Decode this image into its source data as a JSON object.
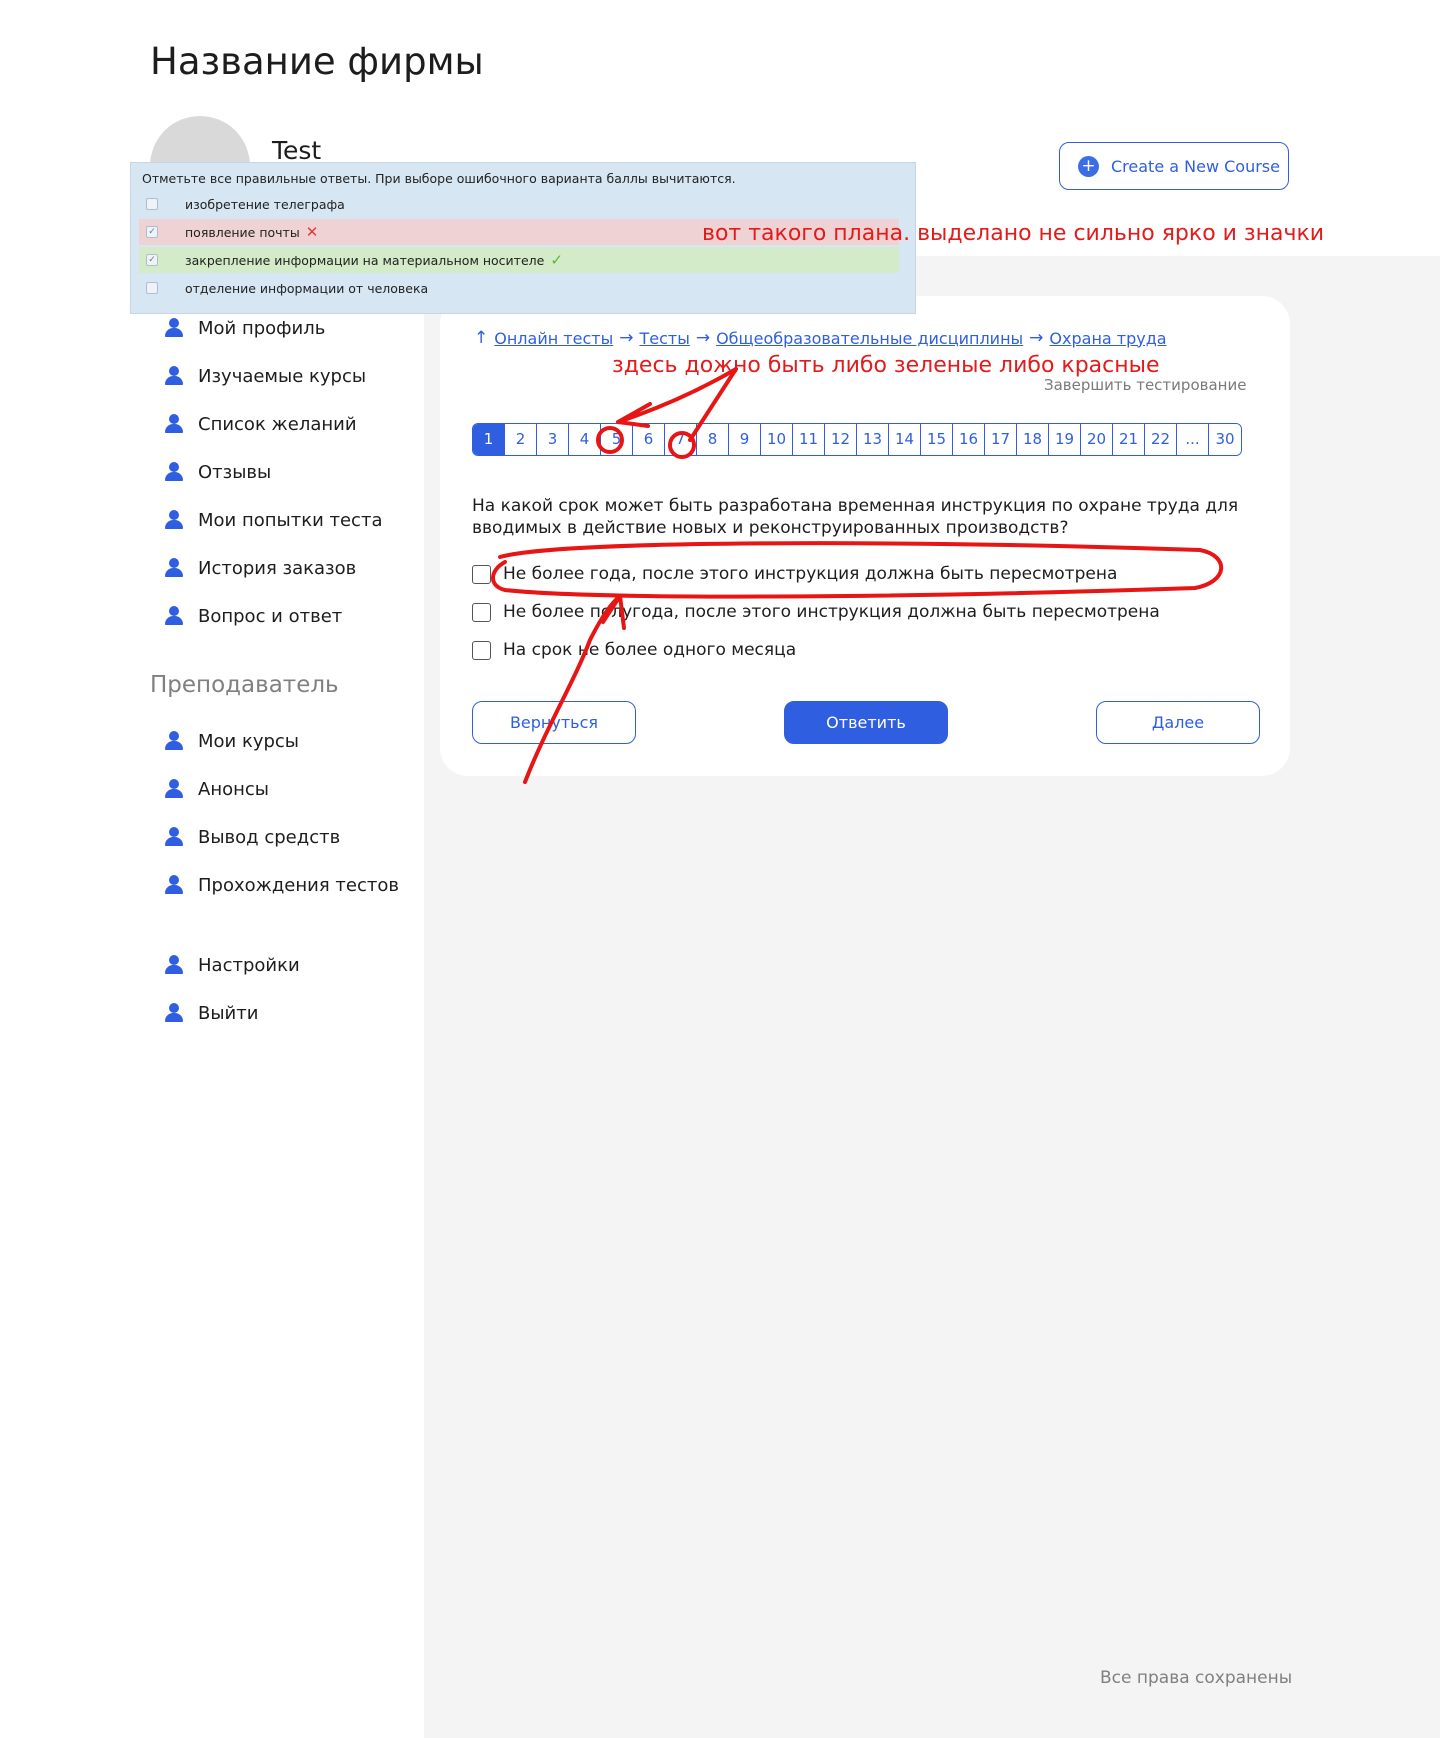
{
  "header": {
    "company_name": "Название фирмы",
    "username": "Test",
    "create_course_label": "Create a New Course"
  },
  "overlay": {
    "hint": "Отметьте все правильные ответы. При выборе ошибочного варианта баллы вычитаются.",
    "options": [
      {
        "label": "изобретение телеграфа",
        "state": "none"
      },
      {
        "label": "появление  почты",
        "state": "wrong"
      },
      {
        "label": "закрепление информации на материальном носителе",
        "state": "correct"
      },
      {
        "label": "отделение информации от человека",
        "state": "none"
      }
    ],
    "wrong_mark": "✕",
    "correct_mark": "✓"
  },
  "notes": {
    "top": "вот такого плана. выделано не сильно ярко и значки",
    "pager": "здесь дожно быть либо зеленые либо красные"
  },
  "sidebar": {
    "student_items": [
      "Мой профиль",
      "Изучаемые курсы",
      "Список желаний",
      "Отзывы",
      "Мои попытки теста",
      "История заказов",
      "Вопрос и ответ"
    ],
    "teacher_heading": "Преподаватель",
    "teacher_items": [
      "Мои курсы",
      "Анонсы",
      "Вывод средств",
      "Прохождения тестов"
    ],
    "bottom_items": [
      "Настройки",
      "Выйти"
    ]
  },
  "breadcrumbs": [
    "Онлайн тесты",
    "Тесты",
    "Общеобразовательные дисциплины",
    "Охрана труда"
  ],
  "finish_label": "Завершить тестирование",
  "pager": {
    "pages": [
      "1",
      "2",
      "3",
      "4",
      "5",
      "6",
      "7",
      "8",
      "9",
      "10",
      "11",
      "12",
      "13",
      "14",
      "15",
      "16",
      "17",
      "18",
      "19",
      "20",
      "21",
      "22",
      "...",
      "30"
    ],
    "active": "1"
  },
  "question": {
    "text": "На какой срок может быть разработана временная инструкция по охране труда для вводимых в действие новых и реконструированных производств?",
    "answers": [
      "Не более года, после этого инструкция должна быть пересмотрена",
      "Не более полугода, после этого инструкция должна быть пересмотрена",
      "На срок не более одного месяца"
    ]
  },
  "buttons": {
    "back": "Вернуться",
    "answer": "Ответить",
    "next": "Далее"
  },
  "footer": "Все права сохранены",
  "colors": {
    "accent": "#2f5fe0",
    "annotation": "#e31b1b"
  }
}
